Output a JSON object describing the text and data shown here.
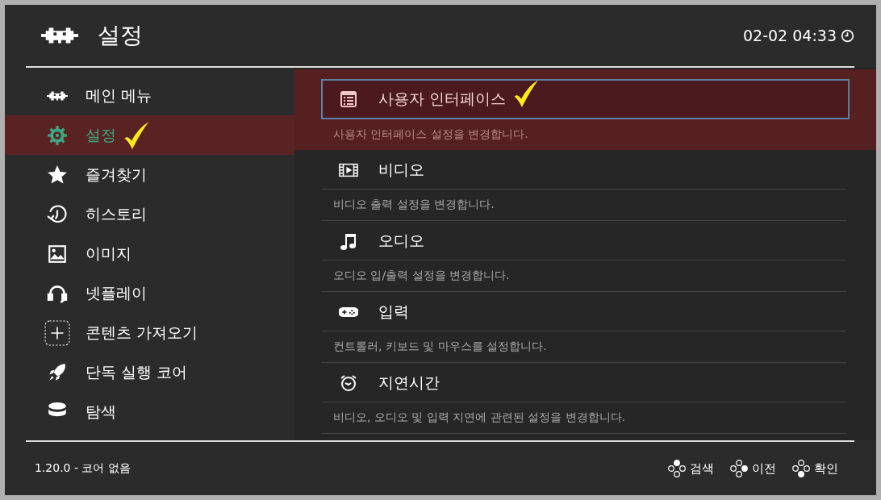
{
  "header": {
    "title": "설정",
    "clock": "02-02 04:33"
  },
  "sidebar": {
    "items": [
      {
        "label": "메인 메뉴",
        "selected": false,
        "marked": false
      },
      {
        "label": "설정",
        "selected": true,
        "marked": true
      },
      {
        "label": "즐겨찾기",
        "selected": false,
        "marked": false
      },
      {
        "label": "히스토리",
        "selected": false,
        "marked": false
      },
      {
        "label": "이미지",
        "selected": false,
        "marked": false
      },
      {
        "label": "넷플레이",
        "selected": false,
        "marked": false
      },
      {
        "label": "콘텐츠 가져오기",
        "selected": false,
        "marked": false
      },
      {
        "label": "단독 실행 코어",
        "selected": false,
        "marked": false
      },
      {
        "label": "탐색",
        "selected": false,
        "marked": false
      }
    ]
  },
  "settings": {
    "items": [
      {
        "label": "사용자 인터페이스",
        "description": "사용자 인터페이스 설정을 변경합니다.",
        "selected": true,
        "marked": true
      },
      {
        "label": "비디오",
        "description": "비디오 출력 설정을 변경합니다.",
        "selected": false,
        "marked": false
      },
      {
        "label": "오디오",
        "description": "오디오 입/출력 설정을 변경합니다.",
        "selected": false,
        "marked": false
      },
      {
        "label": "입력",
        "description": "컨트롤러, 키보드 및 마우스를 설정합니다.",
        "selected": false,
        "marked": false
      },
      {
        "label": "지연시간",
        "description": "비디오, 오디오 및 입력 지연에 관련된 설정을 변경합니다.",
        "selected": false,
        "marked": false
      }
    ]
  },
  "status_bar": {
    "version": "1.20.0 - 코어 없음",
    "hints": [
      {
        "label": "검색"
      },
      {
        "label": "이전"
      },
      {
        "label": "확인"
      }
    ]
  }
}
